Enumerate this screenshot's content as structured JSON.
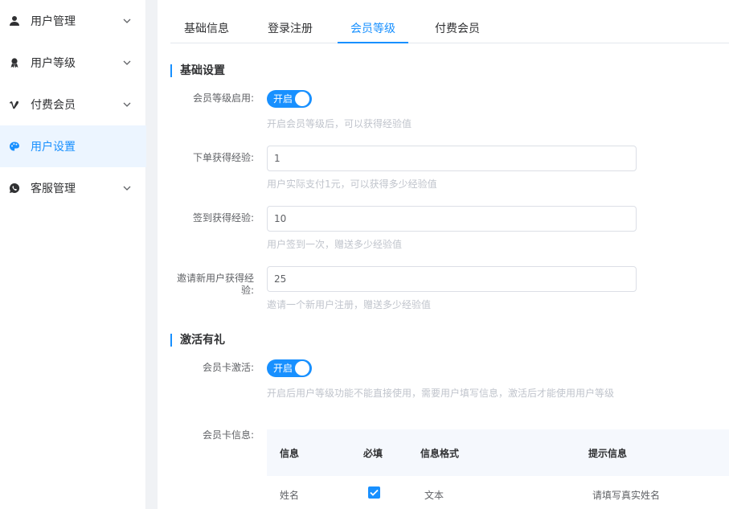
{
  "sidebar": {
    "items": [
      {
        "label": "用户管理",
        "icon": "user-icon"
      },
      {
        "label": "用户等级",
        "icon": "award-icon"
      },
      {
        "label": "付费会员",
        "icon": "vimeo-v-icon"
      },
      {
        "label": "用户设置",
        "icon": "palette-icon",
        "active": true
      },
      {
        "label": "客服管理",
        "icon": "whatsapp-icon"
      }
    ]
  },
  "tabs": [
    {
      "label": "基础信息"
    },
    {
      "label": "登录注册"
    },
    {
      "label": "会员等级",
      "active": true
    },
    {
      "label": "付费会员"
    }
  ],
  "basic": {
    "title": "基础设置",
    "enable_label": "会员等级启用:",
    "enable_switch": "开启",
    "enable_help": "开启会员等级后，可以获得经验值",
    "order_label": "下单获得经验:",
    "order_value": "1",
    "order_help": "用户实际支付1元，可以获得多少经验值",
    "signin_label": "签到获得经验:",
    "signin_value": "10",
    "signin_help": "用户签到一次，赠送多少经验值",
    "invite_label_line1": "邀请新用户获得经",
    "invite_label_line2": "验:",
    "invite_value": "25",
    "invite_help": "邀请一个新用户注册，赠送多少经验值"
  },
  "activate": {
    "title": "激活有礼",
    "card_label": "会员卡激活:",
    "card_switch": "开启",
    "card_help": "开启后用户等级功能不能直接使用，需要用户填写信息，激活后才能使用用户等级",
    "info_label": "会员卡信息:",
    "table": {
      "headers": [
        "信息",
        "必填",
        "信息格式",
        "提示信息"
      ],
      "rows": [
        {
          "info": "姓名",
          "required": true,
          "format": "文本",
          "hint": "请填写真实姓名"
        }
      ]
    }
  },
  "colors": {
    "accent": "#1890ff",
    "active_bg": "#ecf5ff"
  }
}
